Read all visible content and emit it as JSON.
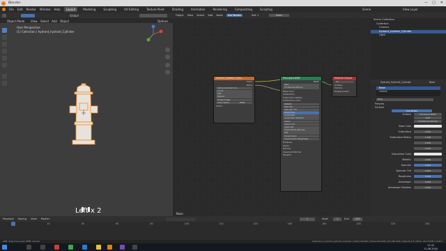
{
  "window": {
    "title": "Blender"
  },
  "menu": {
    "items": [
      "File",
      "Edit",
      "Render",
      "Window",
      "Help"
    ],
    "workspaces": [
      "Layout",
      "Modeling",
      "Sculpting",
      "UV Editing",
      "Texture Paint",
      "Shading",
      "Animation",
      "Rendering",
      "Compositing",
      "Scripting"
    ],
    "active_workspace": "Layout",
    "scene_label": "Scene",
    "view_layer_label": "View Layer"
  },
  "viewport": {
    "mode": "Object Mode",
    "menus": [
      "View",
      "Select",
      "Add",
      "Object"
    ],
    "global_label": "Global",
    "options_label": "Options",
    "view_name": "User Perspective",
    "collection_label": "(1) Collection | hydrant_hydrant_Cylinder",
    "key_cast": "Left x 2"
  },
  "node_editor": {
    "header": [
      "Object",
      "View",
      "Select",
      "Add",
      "Node"
    ],
    "use_nodes_label": "Use Nodes",
    "slot_label": "Slot 1",
    "material_label": "Base",
    "bottom_label": "Base",
    "image_node": {
      "title": "hydrant_hydrant_Cylin...",
      "outputs": [
        "Color",
        "Alpha"
      ],
      "image_name": "hydrant_hydrant_Cy...",
      "fields": [
        "Linear",
        "Flat",
        "Repeat",
        "Single Image"
      ],
      "color_space_label": "Color Space",
      "color_space_value": "sRGB",
      "vector_label": "Vector"
    },
    "bsdf_node": {
      "title": "Principled BSDF",
      "output": "BSDF",
      "rows": [
        "GGX",
        "Christensen-Burley",
        "Base Color",
        "Subsurface",
        "Subsurface Radius",
        "Subsurface Color",
        "Metallic",
        "Specular",
        "Specular Tint",
        "Roughness",
        "Anisotropic",
        "Anisotropic Rotation",
        "Sheen",
        "Sheen Tint",
        "Clearcoat",
        "Clearcoat Roughness",
        "IOR",
        "Transmission",
        "Transmission Roughness",
        "Emission",
        "Alpha",
        "Normal",
        "Clearcoat Normal",
        "Tangent"
      ]
    },
    "output_node": {
      "title": "Material Output",
      "target": "All",
      "inputs": [
        "Surface",
        "Volume",
        "Displacement"
      ]
    }
  },
  "outliner": {
    "rows": [
      {
        "label": "Scene Collection",
        "selected": false
      },
      {
        "label": "Collection",
        "selected": false
      },
      {
        "label": "Camera",
        "selected": false
      },
      {
        "label": "hydrant_hydrant_Cylinder",
        "selected": true
      },
      {
        "label": "Light",
        "selected": false
      }
    ]
  },
  "properties": {
    "object_name": "hydrant_hydrant_Cylinder",
    "material_name": "Base",
    "slots": [
      "Base",
      "chains"
    ],
    "mat_field": "Base",
    "sections": [
      "Preview",
      "Surface"
    ],
    "use_nodes_label": "Use Nodes",
    "surface_label": "Surface",
    "surface_value": "Principled BSDF",
    "dist_value": "GGX",
    "sss_value": "Christensen-Burley",
    "params": [
      {
        "label": "Base Color",
        "value": ""
      },
      {
        "label": "Subsurface",
        "value": "0.000"
      },
      {
        "label": "Subsurface Radius",
        "value": "1.000"
      },
      {
        "label": "",
        "value": "0.200"
      },
      {
        "label": "",
        "value": "0.100"
      },
      {
        "label": "Subsurface Color",
        "value": ""
      },
      {
        "label": "Metallic",
        "value": "0.000"
      },
      {
        "label": "Specular",
        "value": "0.500"
      },
      {
        "label": "Specular Tint",
        "value": "0.000"
      },
      {
        "label": "Roughness",
        "value": "0.500"
      },
      {
        "label": "Anisotropic",
        "value": "0.000"
      },
      {
        "label": "Anisotropic Rotation",
        "value": "0.000"
      }
    ]
  },
  "timeline": {
    "menus": [
      "Playback",
      "Keying",
      "View",
      "Marker"
    ],
    "current_frame": "1",
    "start_label": "Start",
    "start_value": "1",
    "end_label": "End",
    "end_value": "250",
    "ticks": [
      "0",
      "20",
      "40",
      "60",
      "80",
      "100",
      "120",
      "140",
      "160",
      "180",
      "200",
      "220",
      "240"
    ]
  },
  "status": {
    "left": "LMB: drag move (evt. RMB: cancel)",
    "right": "Collection | hydrant_hydrant_Cylinder | Verts:140,997 | Faces:141,638 | Tris:281,804 | Objects:1/3 | Mem: 211.6 MiB | v2.82.7"
  },
  "taskbar": {
    "time": "11:32",
    "date": "11.06.2020"
  },
  "colors": {
    "accent": "#4772b3",
    "image_node_header": "#c26b32",
    "bsdf_header": "#2a7c4f",
    "output_header": "#a53232",
    "hydrant": "#e8e2dc",
    "selection_outline": "#f08b16"
  }
}
